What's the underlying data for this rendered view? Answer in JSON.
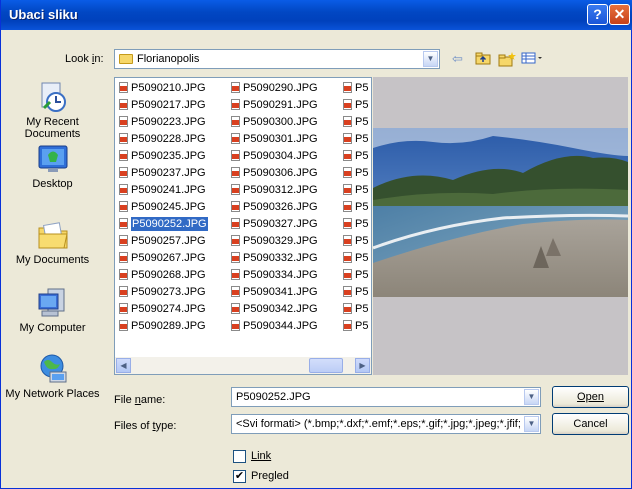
{
  "window": {
    "title": "Ubaci sliku",
    "help_glyph": "?",
    "close_glyph": "✕"
  },
  "look_in": {
    "label": "Look in:",
    "value": "Florianopolis"
  },
  "places": [
    {
      "label": "My Recent Documents"
    },
    {
      "label": "Desktop"
    },
    {
      "label": "My Documents"
    },
    {
      "label": "My Computer"
    },
    {
      "label": "My Network Places"
    }
  ],
  "files": {
    "col1": [
      "P5090210.JPG",
      "P5090217.JPG",
      "P5090223.JPG",
      "P5090228.JPG",
      "P5090235.JPG",
      "P5090237.JPG",
      "P5090241.JPG",
      "P5090245.JPG",
      "P5090252.JPG",
      "P5090257.JPG",
      "P5090267.JPG",
      "P5090268.JPG",
      "P5090273.JPG",
      "P5090274.JPG",
      "P5090289.JPG"
    ],
    "col2": [
      "P5090290.JPG",
      "P5090291.JPG",
      "P5090300.JPG",
      "P5090301.JPG",
      "P5090304.JPG",
      "P5090306.JPG",
      "P5090312.JPG",
      "P5090326.JPG",
      "P5090327.JPG",
      "P5090329.JPG",
      "P5090332.JPG",
      "P5090334.JPG",
      "P5090341.JPG",
      "P5090342.JPG",
      "P5090344.JPG"
    ],
    "col3": [
      "P5",
      "P5",
      "P5",
      "P5",
      "P5",
      "P5",
      "P5",
      "P5",
      "P5",
      "P5",
      "P5",
      "P5",
      "P5",
      "P5",
      "P5"
    ],
    "selected": "P5090252.JPG"
  },
  "file_name": {
    "label": "File name:",
    "value": "P5090252.JPG"
  },
  "file_type": {
    "label": "Files of type:",
    "value": "<Svi formati> (*.bmp;*.dxf;*.emf;*.eps;*.gif;*.jpg;*.jpeg;*.jfif;*.jp"
  },
  "buttons": {
    "open": "Open",
    "cancel": "Cancel"
  },
  "link": {
    "label": "Link",
    "checked": false
  },
  "pregled": {
    "label": "Pregled",
    "checked": true
  }
}
